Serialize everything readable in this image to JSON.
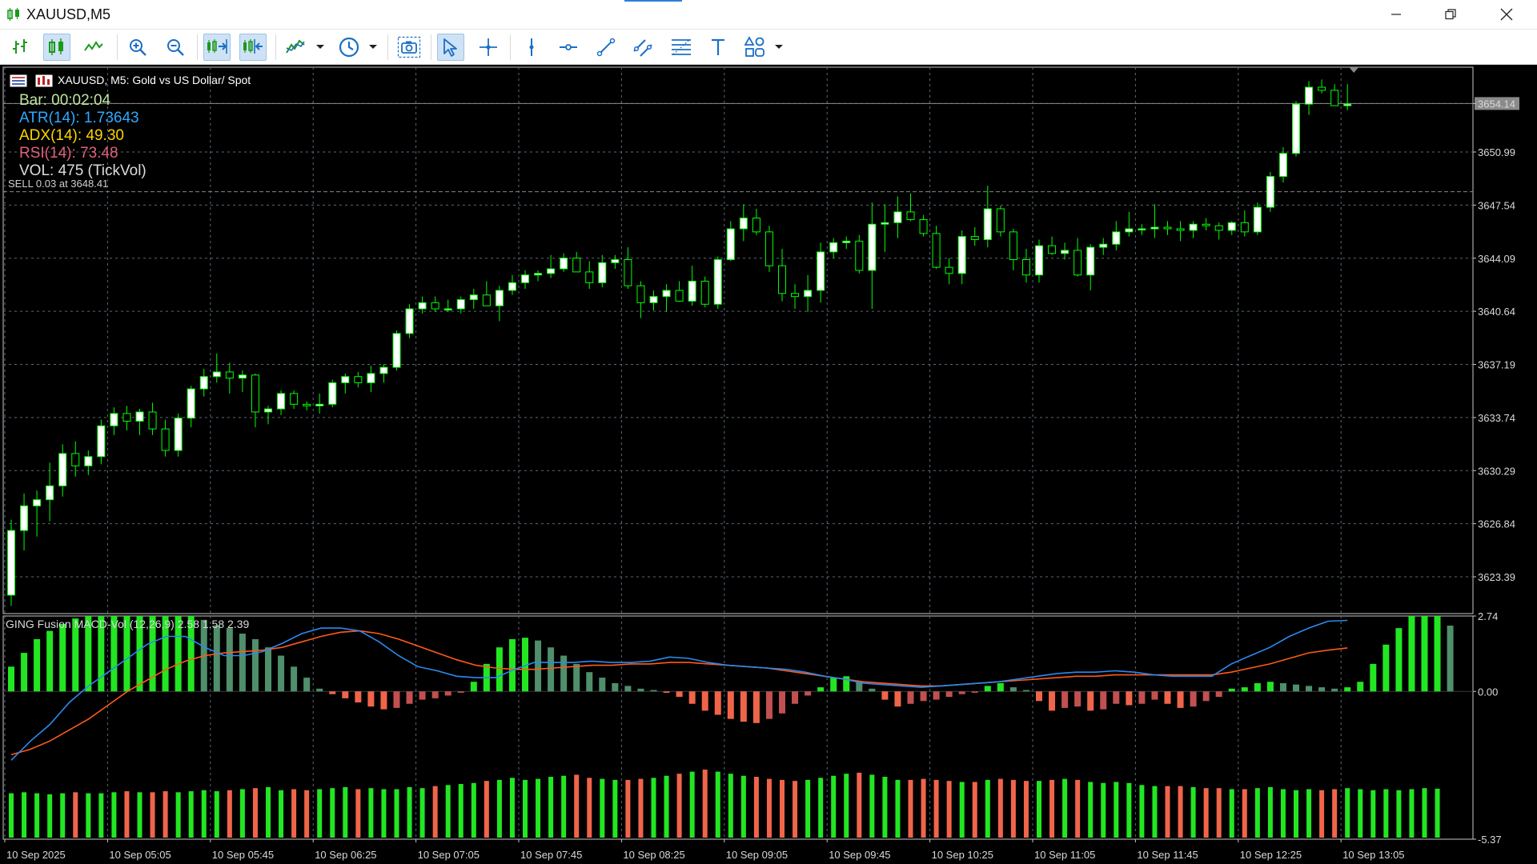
{
  "window": {
    "title": "XAUUSD,M5"
  },
  "toolbar": {
    "buttons": [
      {
        "name": "bar-chart-icon"
      },
      {
        "name": "candlestick-chart-icon",
        "active": true
      },
      {
        "name": "line-chart-icon"
      },
      {
        "name": "zoom-in-icon"
      },
      {
        "name": "zoom-out-icon"
      },
      {
        "name": "auto-scroll-icon",
        "active": true
      },
      {
        "name": "chart-shift-icon",
        "active": true
      },
      {
        "name": "indicators-icon"
      },
      {
        "name": "timeframes-icon"
      },
      {
        "name": "screenshot-icon"
      },
      {
        "name": "cursor-icon",
        "active": true
      },
      {
        "name": "crosshair-icon"
      },
      {
        "name": "vertical-line-icon"
      },
      {
        "name": "horizontal-line-icon"
      },
      {
        "name": "trendline-icon"
      },
      {
        "name": "equidistant-channel-icon"
      },
      {
        "name": "fibonacci-icon"
      },
      {
        "name": "text-icon"
      },
      {
        "name": "shapes-icon"
      }
    ]
  },
  "chart": {
    "symbol_description": "XAUUSD, M5:  Gold vs US Dollar/ Spot",
    "indicators": {
      "bar": "Bar: 00:02:04",
      "atr": "ATR(14): 1.73643",
      "adx": "ADX(14): 49.30",
      "rsi": "RSI(14): 73.48",
      "vol": "VOL: 475 (TickVol)"
    },
    "sell_line_label": "SELL 0.03 at 3648.41",
    "current_price_label": "3654.14",
    "macd_label": "GING Fusion MACD-Vol (12,26,9) 2.58 1.58 2.39",
    "colors": {
      "bull": "#ffffff",
      "bear": "#000000",
      "wick": "#00ff00",
      "grid": "#5a6a78",
      "hist_up": "#22e622",
      "hist_fade": "#4f8f6b",
      "hist_down": "#f0654a",
      "hist_down_fade": "#c25050",
      "macd_line": "#2b8af0",
      "signal_line": "#ff5a1a",
      "bar_color": "#bfe4a0",
      "adx_color": "#ffd300",
      "atr_color": "#2fa8ff",
      "rsi_color": "#e0607a",
      "vol_color": "#dcdcdc"
    }
  },
  "chart_data": [
    {
      "type": "candlestick",
      "title": "XAUUSD, M5:  Gold vs US Dollar/ Spot",
      "y_ticks": [
        "3654.14",
        "3650.99",
        "3647.54",
        "3644.09",
        "3640.64",
        "3637.19",
        "3633.74",
        "3630.29",
        "3626.84",
        "3623.39"
      ],
      "x_ticks": [
        "10 Sep 2025",
        "10 Sep 05:05",
        "10 Sep 05:45",
        "10 Sep 06:25",
        "10 Sep 07:05",
        "10 Sep 07:45",
        "10 Sep 08:25",
        "10 Sep 09:05",
        "10 Sep 09:45",
        "10 Sep 10:25",
        "10 Sep 11:05",
        "10 Sep 11:45",
        "10 Sep 12:25",
        "10 Sep 13:05"
      ],
      "ylim": [
        3621.0,
        3656.5
      ],
      "horizontal_lines": [
        {
          "price": 3648.41,
          "label": "SELL 0.03 at 3648.41"
        },
        {
          "price": 3654.14,
          "label": "3654.14"
        }
      ],
      "ohlc": [
        [
          3622.2,
          3627.1,
          3621.5,
          3626.4
        ],
        [
          3626.4,
          3628.8,
          3625.1,
          3628.0
        ],
        [
          3628.0,
          3629.0,
          3626.0,
          3628.4
        ],
        [
          3628.4,
          3630.8,
          3627.0,
          3629.3
        ],
        [
          3629.3,
          3632.0,
          3628.6,
          3631.4
        ],
        [
          3631.4,
          3632.2,
          3629.9,
          3630.6
        ],
        [
          3630.6,
          3631.6,
          3630.0,
          3631.2
        ],
        [
          3631.2,
          3633.6,
          3630.7,
          3633.2
        ],
        [
          3633.2,
          3634.4,
          3632.6,
          3634.0
        ],
        [
          3634.0,
          3634.5,
          3632.9,
          3633.5
        ],
        [
          3633.5,
          3634.3,
          3632.6,
          3634.1
        ],
        [
          3634.1,
          3634.7,
          3632.6,
          3633.0
        ],
        [
          3633.0,
          3633.6,
          3631.2,
          3631.6
        ],
        [
          3631.6,
          3634.0,
          3631.2,
          3633.7
        ],
        [
          3633.7,
          3635.8,
          3633.1,
          3635.6
        ],
        [
          3635.6,
          3636.9,
          3635.1,
          3636.4
        ],
        [
          3636.4,
          3637.9,
          3636.0,
          3636.7
        ],
        [
          3636.7,
          3637.3,
          3635.3,
          3636.3
        ],
        [
          3636.3,
          3636.8,
          3635.4,
          3636.5
        ],
        [
          3636.5,
          3636.6,
          3633.1,
          3634.1
        ],
        [
          3634.1,
          3634.5,
          3633.3,
          3634.3
        ],
        [
          3634.3,
          3635.5,
          3633.9,
          3635.3
        ],
        [
          3635.3,
          3635.5,
          3634.3,
          3634.6
        ],
        [
          3634.6,
          3634.8,
          3634.2,
          3634.5
        ],
        [
          3634.5,
          3635.3,
          3634.0,
          3634.6
        ],
        [
          3634.6,
          3636.2,
          3634.4,
          3636.0
        ],
        [
          3636.0,
          3636.6,
          3635.3,
          3636.4
        ],
        [
          3636.4,
          3636.7,
          3635.7,
          3636.0
        ],
        [
          3636.0,
          3637.1,
          3635.4,
          3636.6
        ],
        [
          3636.6,
          3637.2,
          3636.0,
          3637.0
        ],
        [
          3637.0,
          3639.4,
          3636.8,
          3639.2
        ],
        [
          3639.2,
          3641.1,
          3638.9,
          3640.8
        ],
        [
          3640.8,
          3641.6,
          3640.5,
          3641.2
        ],
        [
          3641.2,
          3641.6,
          3640.6,
          3640.8
        ],
        [
          3640.8,
          3641.4,
          3640.6,
          3640.8
        ],
        [
          3640.8,
          3641.6,
          3640.5,
          3641.4
        ],
        [
          3641.4,
          3642.1,
          3640.8,
          3641.7
        ],
        [
          3641.7,
          3642.6,
          3641.2,
          3641.0
        ],
        [
          3641.0,
          3642.3,
          3640.0,
          3642.0
        ],
        [
          3642.0,
          3643.0,
          3641.7,
          3642.5
        ],
        [
          3642.5,
          3643.3,
          3642.1,
          3643.0
        ],
        [
          3643.0,
          3643.3,
          3642.6,
          3643.1
        ],
        [
          3643.1,
          3644.3,
          3642.8,
          3643.4
        ],
        [
          3643.4,
          3644.4,
          3643.2,
          3644.1
        ],
        [
          3644.1,
          3644.5,
          3643.2,
          3643.2
        ],
        [
          3643.2,
          3643.9,
          3642.1,
          3642.5
        ],
        [
          3642.5,
          3644.3,
          3642.2,
          3643.8
        ],
        [
          3643.8,
          3644.3,
          3643.4,
          3644.0
        ],
        [
          3644.0,
          3644.8,
          3642.1,
          3642.3
        ],
        [
          3642.3,
          3642.6,
          3640.2,
          3641.2
        ],
        [
          3641.2,
          3642.0,
          3640.7,
          3641.6
        ],
        [
          3641.6,
          3642.4,
          3640.6,
          3642.0
        ],
        [
          3642.0,
          3642.6,
          3641.3,
          3641.3
        ],
        [
          3641.3,
          3643.6,
          3641.0,
          3642.6
        ],
        [
          3642.6,
          3642.9,
          3640.9,
          3641.1
        ],
        [
          3641.1,
          3644.2,
          3640.8,
          3644.0
        ],
        [
          3644.0,
          3646.5,
          3643.9,
          3646.0
        ],
        [
          3646.0,
          3647.6,
          3645.2,
          3646.7
        ],
        [
          3646.7,
          3647.3,
          3645.6,
          3645.8
        ],
        [
          3645.8,
          3646.2,
          3643.2,
          3643.6
        ],
        [
          3643.6,
          3644.7,
          3641.3,
          3641.8
        ],
        [
          3641.8,
          3642.4,
          3640.8,
          3641.6
        ],
        [
          3641.6,
          3643.0,
          3640.6,
          3642.0
        ],
        [
          3642.0,
          3645.1,
          3641.2,
          3644.5
        ],
        [
          3644.5,
          3645.4,
          3644.1,
          3645.1
        ],
        [
          3645.1,
          3645.5,
          3644.7,
          3645.2
        ],
        [
          3645.2,
          3645.6,
          3643.1,
          3643.3
        ],
        [
          3643.3,
          3647.7,
          3640.8,
          3646.3
        ],
        [
          3646.3,
          3647.6,
          3644.5,
          3646.4
        ],
        [
          3646.4,
          3648.1,
          3645.4,
          3647.1
        ],
        [
          3647.1,
          3648.3,
          3646.5,
          3646.6
        ],
        [
          3646.6,
          3646.9,
          3645.5,
          3645.7
        ],
        [
          3645.7,
          3646.2,
          3643.4,
          3643.5
        ],
        [
          3643.5,
          3644.1,
          3642.4,
          3643.1
        ],
        [
          3643.1,
          3645.9,
          3642.4,
          3645.5
        ],
        [
          3645.5,
          3646.1,
          3644.9,
          3645.3
        ],
        [
          3645.3,
          3648.8,
          3644.8,
          3647.3
        ],
        [
          3647.3,
          3647.5,
          3645.5,
          3645.8
        ],
        [
          3645.8,
          3646.0,
          3643.3,
          3644.0
        ],
        [
          3644.0,
          3644.7,
          3642.5,
          3643.0
        ],
        [
          3643.0,
          3645.3,
          3642.5,
          3644.9
        ],
        [
          3644.9,
          3645.5,
          3644.3,
          3644.4
        ],
        [
          3644.4,
          3645.1,
          3644.0,
          3644.6
        ],
        [
          3644.6,
          3645.4,
          3642.9,
          3643.0
        ],
        [
          3643.0,
          3645.0,
          3642.0,
          3644.8
        ],
        [
          3644.8,
          3645.4,
          3644.3,
          3645.0
        ],
        [
          3645.0,
          3646.5,
          3644.6,
          3645.8
        ],
        [
          3645.8,
          3647.1,
          3645.5,
          3646.0
        ],
        [
          3646.0,
          3646.3,
          3645.6,
          3646.0
        ],
        [
          3646.0,
          3647.6,
          3645.4,
          3646.1
        ],
        [
          3646.1,
          3646.5,
          3645.6,
          3646.0
        ],
        [
          3646.0,
          3646.5,
          3645.2,
          3645.9
        ],
        [
          3645.9,
          3646.5,
          3645.4,
          3646.3
        ],
        [
          3646.3,
          3646.7,
          3645.9,
          3646.2
        ],
        [
          3646.2,
          3646.4,
          3645.3,
          3645.9
        ],
        [
          3645.9,
          3646.5,
          3645.6,
          3646.4
        ],
        [
          3646.4,
          3647.2,
          3645.5,
          3645.8
        ],
        [
          3645.8,
          3647.7,
          3645.6,
          3647.4
        ],
        [
          3647.4,
          3649.7,
          3647.1,
          3649.4
        ],
        [
          3649.4,
          3651.3,
          3649.0,
          3650.9
        ],
        [
          3650.9,
          3654.3,
          3650.7,
          3654.1
        ],
        [
          3654.1,
          3655.6,
          3653.4,
          3655.2
        ],
        [
          3655.2,
          3655.7,
          3654.8,
          3655.0
        ],
        [
          3655.0,
          3655.4,
          3654.0,
          3654.0
        ],
        [
          3654.0,
          3655.4,
          3653.7,
          3654.1
        ]
      ]
    },
    {
      "type": "bar",
      "title": "GING Fusion MACD-Vol (12,26,9) 2.58 1.58 2.39",
      "y_ticks": [
        "2.74",
        "0.00",
        "-5.37"
      ],
      "ylim": [
        -5.37,
        2.74
      ],
      "series": [
        {
          "name": "histogram",
          "values": [
            0.9,
            1.4,
            1.9,
            2.2,
            2.45,
            2.65,
            2.74,
            2.74,
            2.74,
            2.74,
            2.74,
            2.74,
            2.74,
            2.74,
            2.74,
            2.6,
            2.4,
            2.3,
            2.1,
            1.9,
            1.6,
            1.3,
            0.9,
            0.5,
            0.1,
            -0.1,
            -0.25,
            -0.4,
            -0.55,
            -0.65,
            -0.6,
            -0.45,
            -0.3,
            -0.25,
            -0.15,
            -0.05,
            0.35,
            1.0,
            1.6,
            1.9,
            1.95,
            1.85,
            1.6,
            1.3,
            1.0,
            0.7,
            0.5,
            0.3,
            0.2,
            0.1,
            0.05,
            -0.05,
            -0.2,
            -0.45,
            -0.7,
            -0.85,
            -1.0,
            -1.1,
            -1.15,
            -1.0,
            -0.8,
            -0.45,
            -0.15,
            0.15,
            0.5,
            0.55,
            0.35,
            0.1,
            -0.3,
            -0.55,
            -0.45,
            -0.35,
            -0.3,
            -0.2,
            -0.1,
            -0.05,
            0.2,
            0.3,
            0.15,
            0.05,
            -0.35,
            -0.7,
            -0.6,
            -0.55,
            -0.7,
            -0.65,
            -0.45,
            -0.5,
            -0.45,
            -0.3,
            -0.45,
            -0.6,
            -0.55,
            -0.35,
            -0.2,
            0.1,
            0.15,
            0.3,
            0.35,
            0.3,
            0.25,
            0.2,
            0.15,
            0.1,
            0.15,
            0.35,
            1.0,
            1.7,
            2.3,
            2.74,
            2.74,
            2.74,
            2.39
          ]
        },
        {
          "name": "macd",
          "values": [
            -2.5,
            -1.8,
            -1.2,
            -0.4,
            0.2,
            0.7,
            1.2,
            1.7,
            2.0,
            2.0,
            1.6,
            1.3,
            1.3,
            1.45,
            1.75,
            2.1,
            2.3,
            2.3,
            2.2,
            1.8,
            1.3,
            0.9,
            0.75,
            0.55,
            0.5,
            0.5,
            0.8,
            1.05,
            1.05,
            1.05,
            1.1,
            1.05,
            1.05,
            1.1,
            1.25,
            1.2,
            1.05,
            0.95,
            0.9,
            0.85,
            0.8,
            0.7,
            0.55,
            0.45,
            0.3,
            0.25,
            0.2,
            0.15,
            0.2,
            0.25,
            0.3,
            0.35,
            0.45,
            0.55,
            0.65,
            0.7,
            0.7,
            0.75,
            0.7,
            0.6,
            0.55,
            0.55,
            0.55,
            1.0,
            1.3,
            1.6,
            2.0,
            2.3,
            2.55,
            2.58
          ]
        },
        {
          "name": "signal",
          "values": [
            -2.3,
            -2.1,
            -1.8,
            -1.4,
            -1.0,
            -0.5,
            0.0,
            0.4,
            0.8,
            1.1,
            1.3,
            1.4,
            1.45,
            1.5,
            1.6,
            1.8,
            2.0,
            2.15,
            2.2,
            2.1,
            1.9,
            1.65,
            1.4,
            1.15,
            0.95,
            0.85,
            0.8,
            0.8,
            0.85,
            0.9,
            0.95,
            0.95,
            1.0,
            1.0,
            1.05,
            1.05,
            1.0,
            0.95,
            0.9,
            0.85,
            0.75,
            0.65,
            0.55,
            0.45,
            0.35,
            0.3,
            0.25,
            0.2,
            0.2,
            0.25,
            0.3,
            0.35,
            0.4,
            0.45,
            0.5,
            0.55,
            0.55,
            0.6,
            0.6,
            0.6,
            0.6,
            0.6,
            0.6,
            0.7,
            0.85,
            1.0,
            1.2,
            1.4,
            1.5,
            1.58
          ]
        },
        {
          "name": "volume",
          "values": [
            430,
            440,
            430,
            420,
            430,
            440,
            430,
            430,
            440,
            450,
            440,
            440,
            450,
            440,
            450,
            460,
            450,
            460,
            470,
            480,
            490,
            460,
            470,
            460,
            470,
            480,
            490,
            470,
            480,
            470,
            470,
            490,
            480,
            500,
            510,
            520,
            530,
            550,
            560,
            580,
            560,
            570,
            590,
            600,
            610,
            580,
            570,
            560,
            560,
            570,
            580,
            600,
            620,
            640,
            660,
            640,
            620,
            600,
            590,
            570,
            560,
            550,
            560,
            580,
            600,
            620,
            630,
            610,
            590,
            560,
            560,
            570,
            560,
            550,
            540,
            540,
            560,
            570,
            560,
            550,
            550,
            560,
            570,
            560,
            540,
            530,
            540,
            530,
            510,
            500,
            500,
            500,
            490,
            480,
            480,
            470,
            470,
            480,
            490,
            470,
            460,
            470,
            460,
            470,
            480,
            470,
            460,
            470,
            460,
            470,
            480,
            475
          ]
        }
      ]
    }
  ]
}
